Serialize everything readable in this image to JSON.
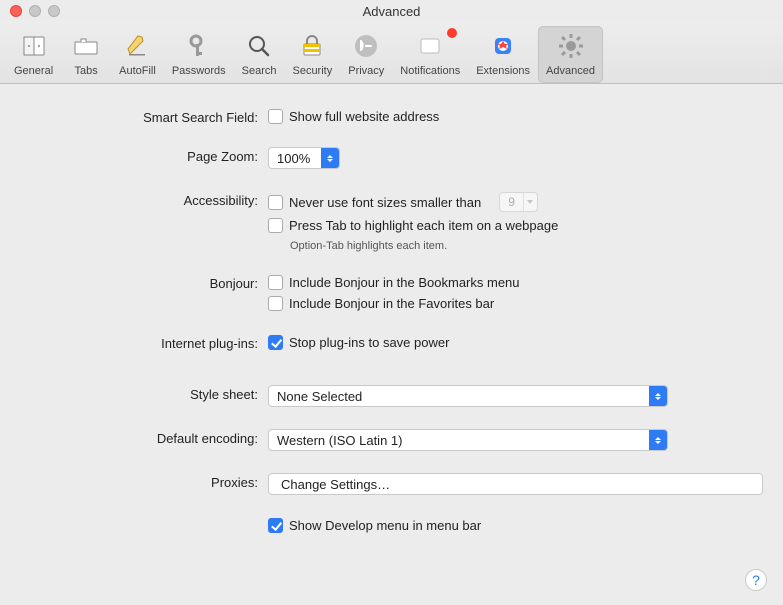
{
  "window": {
    "title": "Advanced"
  },
  "toolbar": {
    "items": [
      {
        "id": "general",
        "label": "General"
      },
      {
        "id": "tabs",
        "label": "Tabs"
      },
      {
        "id": "autofill",
        "label": "AutoFill"
      },
      {
        "id": "passwords",
        "label": "Passwords"
      },
      {
        "id": "search",
        "label": "Search"
      },
      {
        "id": "security",
        "label": "Security"
      },
      {
        "id": "privacy",
        "label": "Privacy"
      },
      {
        "id": "notifications",
        "label": "Notifications"
      },
      {
        "id": "extensions",
        "label": "Extensions"
      },
      {
        "id": "advanced",
        "label": "Advanced"
      }
    ],
    "selected": "advanced",
    "badge_on": "notifications"
  },
  "sections": {
    "smart_search": {
      "label": "Smart Search Field:",
      "show_full_url": {
        "checked": false,
        "label": "Show full website address"
      }
    },
    "page_zoom": {
      "label": "Page Zoom:",
      "value": "100%"
    },
    "accessibility": {
      "label": "Accessibility:",
      "min_font": {
        "checked": false,
        "label": "Never use font sizes smaller than",
        "value": "9"
      },
      "press_tab": {
        "checked": false,
        "label": "Press Tab to highlight each item on a webpage"
      },
      "hint": "Option-Tab highlights each item."
    },
    "bonjour": {
      "label": "Bonjour:",
      "bookmarks": {
        "checked": false,
        "label": "Include Bonjour in the Bookmarks menu"
      },
      "favorites": {
        "checked": false,
        "label": "Include Bonjour in the Favorites bar"
      }
    },
    "plugins": {
      "label": "Internet plug-ins:",
      "stop_to_save_power": {
        "checked": true,
        "label": "Stop plug-ins to save power"
      }
    },
    "stylesheet": {
      "label": "Style sheet:",
      "value": "None Selected"
    },
    "encoding": {
      "label": "Default encoding:",
      "value": "Western (ISO Latin 1)"
    },
    "proxies": {
      "label": "Proxies:",
      "button": "Change Settings…"
    },
    "develop": {
      "checked": true,
      "label": "Show Develop menu in menu bar"
    }
  },
  "help_glyph": "?"
}
